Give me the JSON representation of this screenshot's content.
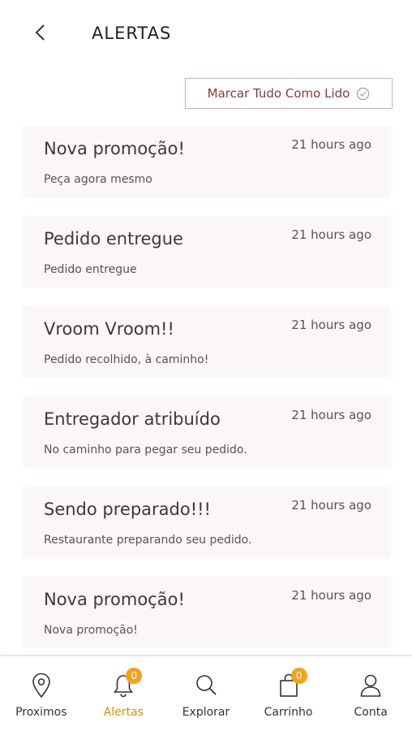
{
  "header": {
    "title": "ALERTAS",
    "back_icon": "chevron-left-icon"
  },
  "actions": {
    "mark_all_label": "Marcar Tudo Como Lido",
    "mark_all_icon": "check-circle-icon"
  },
  "alerts": [
    {
      "title": "Nova promoção!",
      "time": "21 hours ago",
      "subtitle": "Peça agora mesmo"
    },
    {
      "title": "Pedido entregue",
      "time": "21 hours ago",
      "subtitle": "Pedido entregue"
    },
    {
      "title": "Vroom Vroom!!",
      "time": "21 hours ago",
      "subtitle": "Pedido recolhido, à caminho!"
    },
    {
      "title": "Entregador atribuído",
      "time": "21 hours ago",
      "subtitle": "No caminho para pegar seu pedido."
    },
    {
      "title": "Sendo preparado!!!",
      "time": "21 hours ago",
      "subtitle": "Restaurante preparando seu pedido."
    },
    {
      "title": "Nova promoção!",
      "time": "21 hours ago",
      "subtitle": "Nova promoção!"
    }
  ],
  "nav": {
    "items": [
      {
        "label": "Proximos",
        "icon": "location-pin-icon"
      },
      {
        "label": "Alertas",
        "icon": "bell-icon",
        "badge": "0"
      },
      {
        "label": "Explorar",
        "icon": "search-icon"
      },
      {
        "label": "Carrinho",
        "icon": "shopping-bag-icon",
        "badge": "0"
      },
      {
        "label": "Conta",
        "icon": "user-icon"
      }
    ],
    "active_color": "#d4900a",
    "badge_color": "#f3a21a"
  },
  "colors": {
    "card_bg": "#fbf7f6",
    "accent_text": "#8a3a3a",
    "button_border": "#c8b4b0"
  }
}
